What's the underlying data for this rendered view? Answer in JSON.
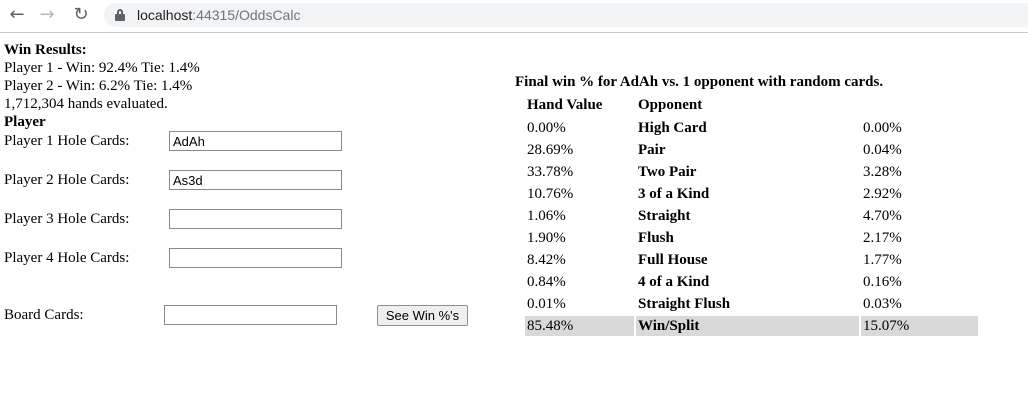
{
  "browser": {
    "url_host": "localhost",
    "url_path": ":44315/OddsCalc"
  },
  "summary": {
    "heading": "Win Results:",
    "lines": [
      "Player 1 - Win: 92.4% Tie: 1.4%",
      "Player 2 - Win: 6.2% Tie: 1.4%",
      "1,712,304 hands evaluated."
    ],
    "player_heading": "Player"
  },
  "form": {
    "player1_label": "Player 1 Hole Cards:",
    "player1_value": "AdAh",
    "player2_label": "Player 2 Hole Cards:",
    "player2_value": "As3d",
    "player3_label": "Player 3 Hole Cards:",
    "player3_value": "",
    "player4_label": "Player 4 Hole Cards:",
    "player4_value": "",
    "board_label": "Board Cards:",
    "board_value": "",
    "submit_label": "See Win %'s"
  },
  "results": {
    "title": "Final win % for AdAh vs. 1 opponent with random cards.",
    "header_hand_value": "Hand Value",
    "header_opponent": "Opponent",
    "rows": [
      {
        "player": "0.00%",
        "hand": "High Card",
        "opponent": "0.00%"
      },
      {
        "player": "28.69%",
        "hand": "Pair",
        "opponent": "0.04%"
      },
      {
        "player": "33.78%",
        "hand": "Two Pair",
        "opponent": "3.28%"
      },
      {
        "player": "10.76%",
        "hand": "3 of a Kind",
        "opponent": "2.92%"
      },
      {
        "player": "1.06%",
        "hand": "Straight",
        "opponent": "4.70%"
      },
      {
        "player": "1.90%",
        "hand": "Flush",
        "opponent": "2.17%"
      },
      {
        "player": "8.42%",
        "hand": "Full House",
        "opponent": "1.77%"
      },
      {
        "player": "0.84%",
        "hand": "4 of a Kind",
        "opponent": "0.16%"
      },
      {
        "player": "0.01%",
        "hand": "Straight Flush",
        "opponent": "0.03%"
      }
    ],
    "total": {
      "player": "85.48%",
      "hand": "Win/Split",
      "opponent": "15.07%"
    }
  }
}
